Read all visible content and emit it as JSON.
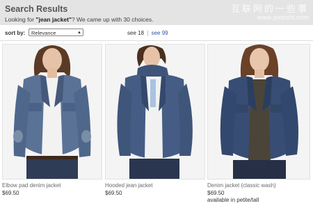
{
  "header": {
    "title": "Search Results",
    "subtitle_prefix": "Looking for ",
    "query": "\"jean jacket\"",
    "subtitle_suffix": "? We came up with 30 choices."
  },
  "watermark": {
    "cn": "互联网的一些事",
    "url": "www.yixieshi.com"
  },
  "controls": {
    "sort_label": "sort by:",
    "sort_value": "Relevance",
    "see_18": "see 18",
    "separator": "|",
    "see_99": "see 99"
  },
  "products": [
    {
      "name": "Elbow pad denim jacket",
      "price": "$69.50",
      "note": ""
    },
    {
      "name": "Hooded jean jacket",
      "price": "$69.50",
      "note": ""
    },
    {
      "name": "Denim jacket (classic wash)",
      "price": "$69.50",
      "note": "available in petite/tall"
    }
  ],
  "colors": {
    "header_bg": "#e4e4e4",
    "link": "#2a57a5",
    "denim_light": "#6f86a6",
    "denim_mid": "#4a6286",
    "denim_dark": "#2d3f5e"
  }
}
